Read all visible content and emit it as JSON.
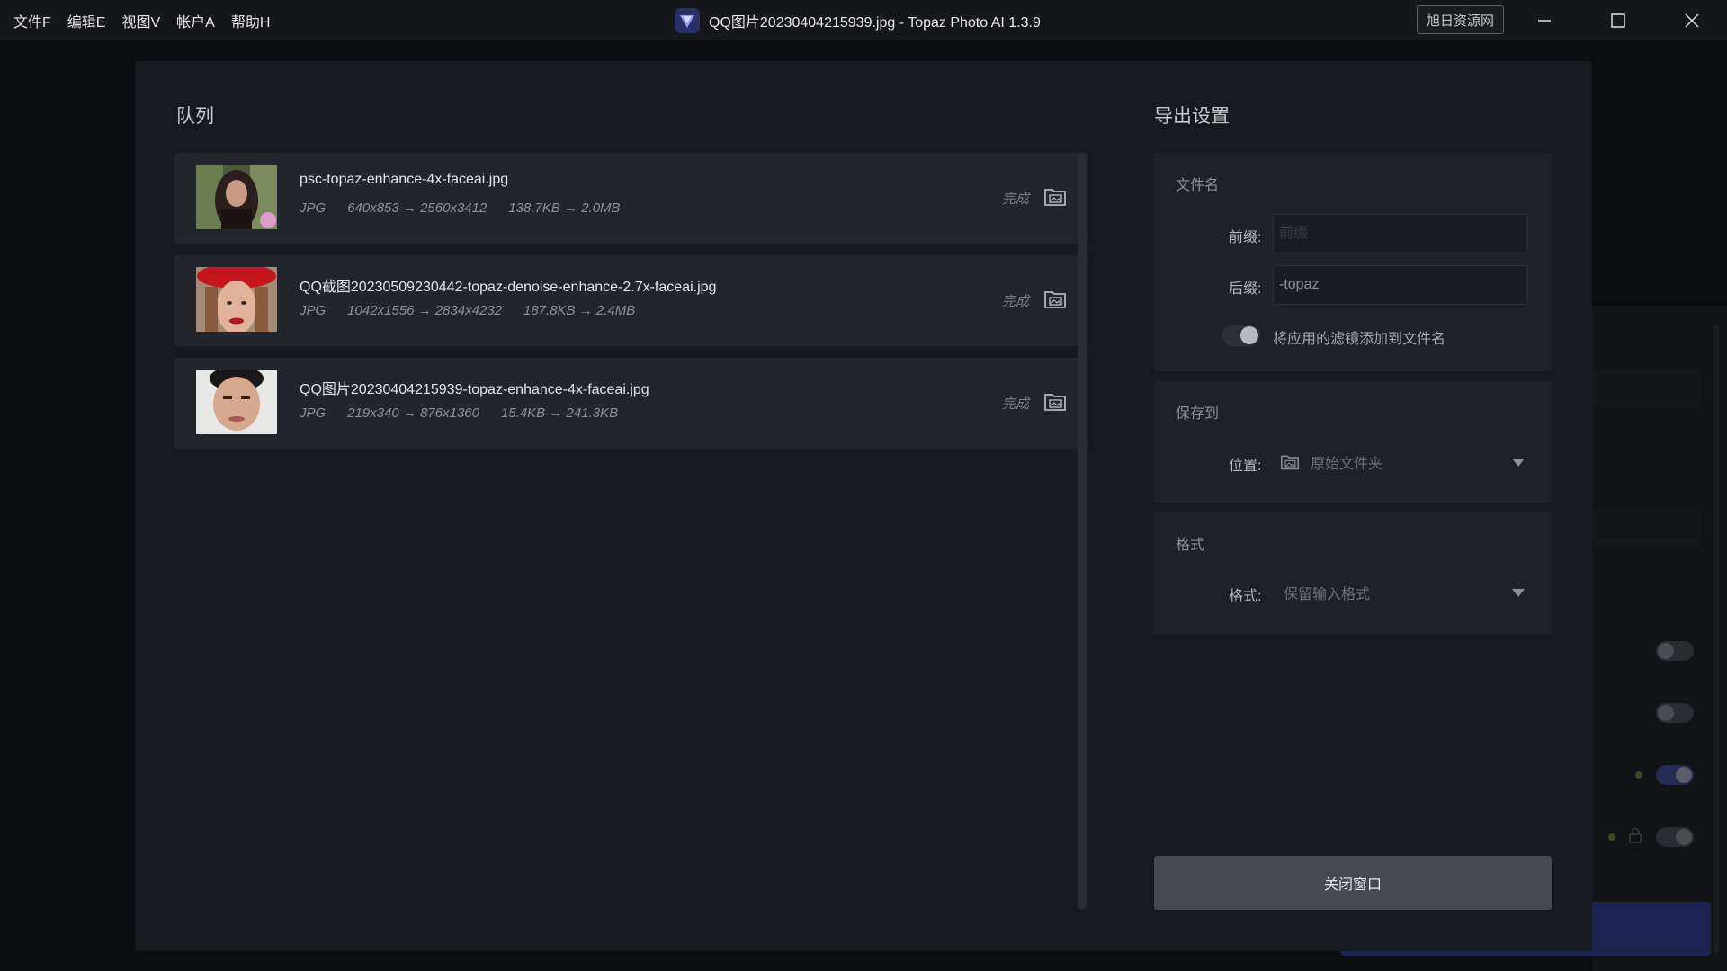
{
  "menu": {
    "items": [
      {
        "label": "文件F"
      },
      {
        "label": "编辑E"
      },
      {
        "label": "视图V"
      },
      {
        "label": "帐户A"
      },
      {
        "label": "帮助H"
      }
    ]
  },
  "titlebar": {
    "title": "QQ图片20230404215939.jpg - Topaz Photo AI 1.3.9",
    "brand_button": "旭日资源网"
  },
  "queue": {
    "title": "队列",
    "items": [
      {
        "name": "psc-topaz-enhance-4x-faceai.jpg",
        "format": "JPG",
        "dims": "640x853 → 2560x3412",
        "size": "138.7KB → 2.0MB",
        "status": "完成"
      },
      {
        "name": "QQ截图20230509230442-topaz-denoise-enhance-2.7x-faceai.jpg",
        "format": "JPG",
        "dims": "1042x1556 → 2834x4232",
        "size": "187.8KB → 2.4MB",
        "status": "完成"
      },
      {
        "name": "QQ图片20230404215939-topaz-enhance-4x-faceai.jpg",
        "format": "JPG",
        "dims": "219x340 → 876x1360",
        "size": "15.4KB → 241.3KB",
        "status": "完成"
      }
    ]
  },
  "export": {
    "title": "导出设置",
    "filename": {
      "title": "文件名",
      "prefix_label": "前缀:",
      "prefix_value": "",
      "prefix_placeholder": "前缀",
      "suffix_label": "后缀:",
      "suffix_value": "-topaz",
      "toggle_label": "将应用的滤镜添加到文件名",
      "toggle_on": true
    },
    "save_to": {
      "title": "保存到",
      "location_label": "位置:",
      "location_value": "原始文件夹"
    },
    "format": {
      "title": "格式",
      "format_label": "格式:",
      "format_value": "保留输入格式"
    },
    "close_button": "关闭窗口"
  },
  "colors": {
    "background": "#0b0c0f",
    "modal": "#17191e",
    "card": "#22252b",
    "accent_blue": "#1c2350"
  }
}
